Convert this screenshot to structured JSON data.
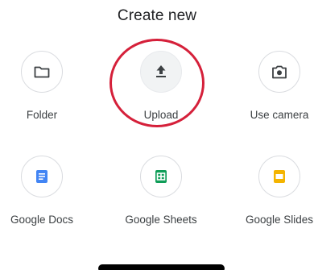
{
  "sheet": {
    "title": "Create new"
  },
  "options": {
    "folder": {
      "label": "Folder",
      "icon": "folder-icon"
    },
    "upload": {
      "label": "Upload",
      "icon": "upload-icon"
    },
    "camera": {
      "label": "Use camera",
      "icon": "camera-icon"
    },
    "docs": {
      "label": "Google Docs",
      "icon": "google-docs-icon",
      "color": "#4285f4"
    },
    "sheets": {
      "label": "Google Sheets",
      "icon": "google-sheets-icon",
      "color": "#0f9d58"
    },
    "slides": {
      "label": "Google Slides",
      "icon": "google-slides-icon",
      "color": "#f4b400"
    }
  },
  "annotation": {
    "highlight_color": "#d5203a"
  }
}
